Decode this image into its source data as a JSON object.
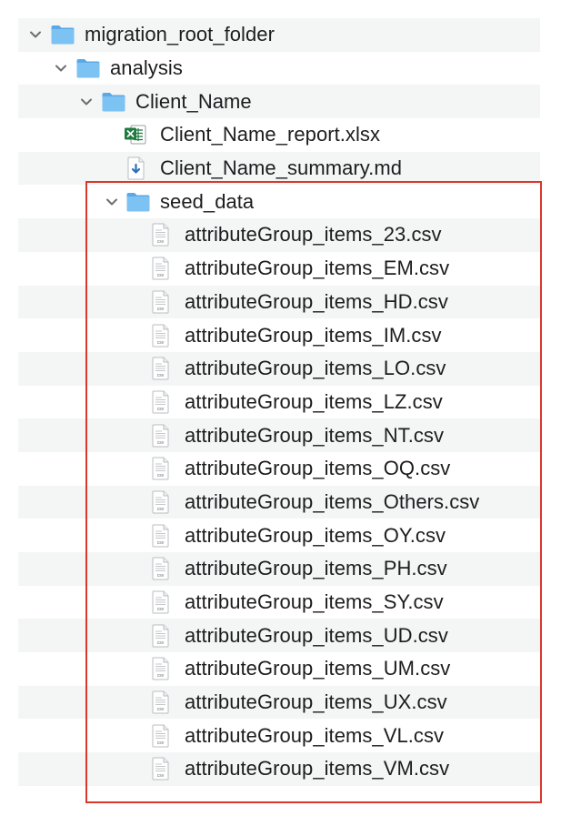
{
  "tree": {
    "root": {
      "label": "migration_root_folder",
      "icon": "folder-icon",
      "expanded": true
    },
    "analysis": {
      "label": "analysis",
      "icon": "folder-icon",
      "expanded": true
    },
    "client": {
      "label": "Client_Name",
      "icon": "folder-icon",
      "expanded": true
    },
    "report": {
      "label": "Client_Name_report.xlsx",
      "icon": "excel-file-icon"
    },
    "summary": {
      "label": "Client_Name_summary.md",
      "icon": "markdown-file-icon"
    },
    "seed": {
      "label": "seed_data",
      "icon": "folder-icon",
      "expanded": true
    },
    "csv_files": [
      "attributeGroup_items_23.csv",
      "attributeGroup_items_EM.csv",
      "attributeGroup_items_HD.csv",
      "attributeGroup_items_IM.csv",
      "attributeGroup_items_LO.csv",
      "attributeGroup_items_LZ.csv",
      "attributeGroup_items_NT.csv",
      "attributeGroup_items_OQ.csv",
      "attributeGroup_items_Others.csv",
      "attributeGroup_items_OY.csv",
      "attributeGroup_items_PH.csv",
      "attributeGroup_items_SY.csv",
      "attributeGroup_items_UD.csv",
      "attributeGroup_items_UM.csv",
      "attributeGroup_items_UX.csv",
      "attributeGroup_items_VL.csv",
      "attributeGroup_items_VM.csv"
    ],
    "csv_icon_text": "csv"
  },
  "colors": {
    "folder": "#6fb8ef",
    "folder_tab": "#5aa9e6",
    "stripe": "#f4f5f5",
    "highlight_border": "#d9382c",
    "excel_green": "#1e7a3f",
    "md_blue": "#2f6fb3"
  }
}
